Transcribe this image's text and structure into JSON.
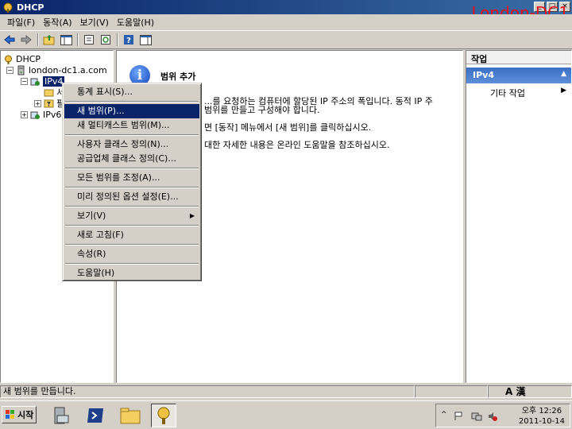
{
  "window": {
    "title": "DHCP",
    "server_label": "London-DC1",
    "buttons": [
      "_",
      "□",
      "×"
    ]
  },
  "menubar": [
    "파일(F)",
    "동작(A)",
    "보기(V)",
    "도움말(H)"
  ],
  "toolbar": {
    "icons": [
      "back-icon",
      "forward-icon",
      "up-icon",
      "show-hide-tree-icon",
      "properties-icon",
      "refresh-icon",
      "help-icon",
      "show-hide-action-pane-icon"
    ]
  },
  "tree": {
    "root": "DHCP",
    "server": "london-dc1.a.com",
    "ipv4": "IPv4",
    "ipv4_child1": "서",
    "ipv4_child2": "필",
    "ipv6": "IPv6"
  },
  "main": {
    "title": "범위 추가",
    "lines": [
      "...를 요청하는 컴퓨터에 할당된 IP 주소의 폭입니다. 동적 IP 주",
      "범위를 만들고 구성해야 합니다.",
      "면 [동작] 메뉴에서 [새 범위]를 클릭하십시오.",
      "대한 자세한 내용은 온라인 도움말을 참조하십시오."
    ]
  },
  "actions": {
    "header": "작업",
    "section": "IPv4",
    "items": [
      "기타 작업"
    ]
  },
  "context_menu": {
    "items": [
      {
        "label": "통계 표시(S)..."
      },
      {
        "label": "새 범위(P)...",
        "highlighted": true
      },
      {
        "label": "새 멀티캐스트 범위(M)..."
      },
      {
        "label": "사용자 클래스 정의(N)..."
      },
      {
        "label": "공급업체 클래스 정의(C)..."
      },
      {
        "label": "모든 범위를 조정(A)..."
      },
      {
        "label": "미리 정의된 옵션 설정(E)..."
      },
      {
        "label": "보기(V)",
        "submenu": true
      },
      {
        "label": "새로 고침(F)"
      },
      {
        "label": "속성(R)"
      },
      {
        "label": "도움말(H)"
      }
    ]
  },
  "status": {
    "text": "새 범위를 만듭니다."
  },
  "taskbar": {
    "start_label": "시작",
    "apps": [
      "server-manager-icon",
      "powershell-icon",
      "explorer-icon",
      "dhcp-icon"
    ],
    "lang": "A 漢",
    "clock_time": "오후 12:26",
    "clock_date": "2011-10-14"
  },
  "colors": {
    "title_bar": "#0a246a",
    "highlight": "#0a246a",
    "server_label": "#e8101a",
    "action_section": "#3a6fc4"
  }
}
